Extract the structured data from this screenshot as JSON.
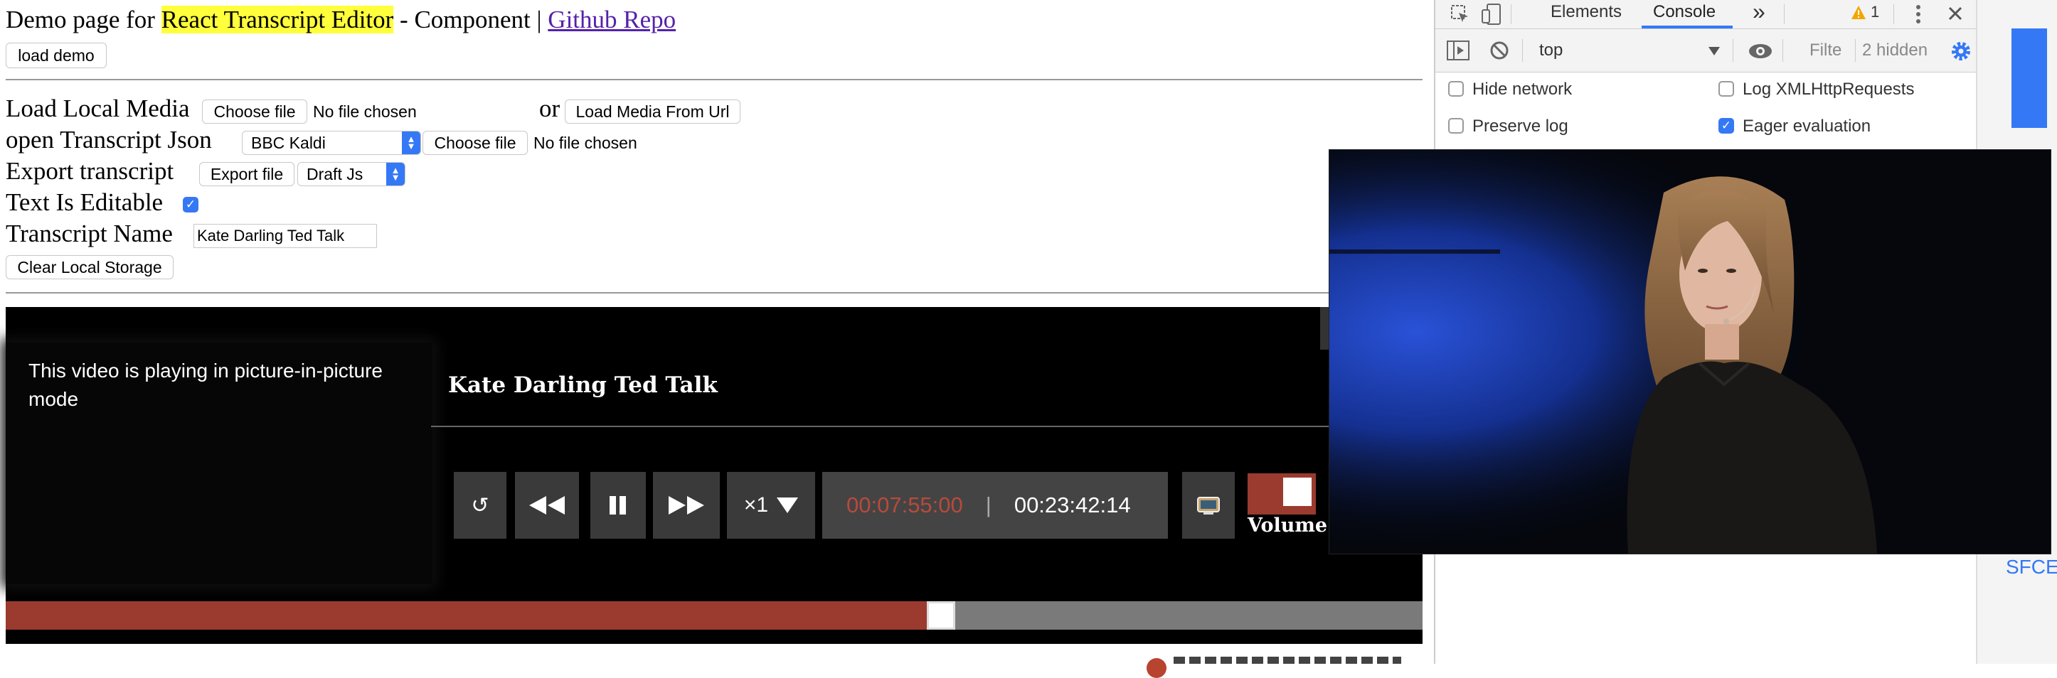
{
  "header": {
    "title_prefix": "Demo page for ",
    "title_highlight": "React Transcript Editor",
    "title_suffix": " - Component | ",
    "repo_link": "Github Repo",
    "load_demo": "load demo"
  },
  "form": {
    "load_media_label": "Load Local Media",
    "choose_file_1": "Choose file",
    "no_file_1": "No file chosen",
    "or_label": "or",
    "load_url_button": "Load Media From Url",
    "open_json_label": "open Transcript Json",
    "sttype_value": "BBC Kaldi",
    "choose_file_2": "Choose file",
    "no_file_2": "No file chosen",
    "export_label": "Export transcript",
    "export_button": "Export file",
    "export_format": "Draft Js",
    "editable_label": "Text Is Editable",
    "editable_checked": true,
    "name_label": "Transcript Name",
    "name_value": "Kate Darling Ted Talk",
    "clear_storage": "Clear Local Storage"
  },
  "player": {
    "pip_message": "This video is playing in picture-in-picture mode",
    "title": "Kate Darling Ted Talk",
    "current_time": "00:07:55:00",
    "separator": "|",
    "duration": "00:23:42:14",
    "playback_rate": "×1",
    "volume_label": "Volume",
    "progress_fraction": 0.66,
    "colors": {
      "accent": "#9b3a2e",
      "bg": "#000000",
      "button": "#3a3a3a",
      "timebox": "#444444"
    }
  },
  "devtools": {
    "tabs": [
      "Elements",
      "Console"
    ],
    "more": "»",
    "warning_count": "1",
    "context": "top",
    "filter_placeholder": "Filte",
    "hidden_count": "2 hidden",
    "options": {
      "hide_network": "Hide network",
      "log_xhr": "Log XMLHttpRequests",
      "preserve_log": "Preserve log",
      "eager_eval": "Eager evaluation"
    },
    "snippet": "SFCE"
  },
  "icons": {
    "inspect": "inspect-icon",
    "device": "device-toolbar-icon",
    "warning": "warning-icon",
    "kebab": "kebab-menu-icon",
    "close": "close-icon",
    "sidebar": "show-sidebar-icon",
    "clear": "clear-console-icon",
    "eye": "eye-icon",
    "gear": "gear-icon",
    "rollback": "rollback-icon",
    "rewind": "rewind-icon",
    "pause": "pause-icon",
    "forward": "fast-forward-icon",
    "pip": "picture-in-picture-icon"
  }
}
